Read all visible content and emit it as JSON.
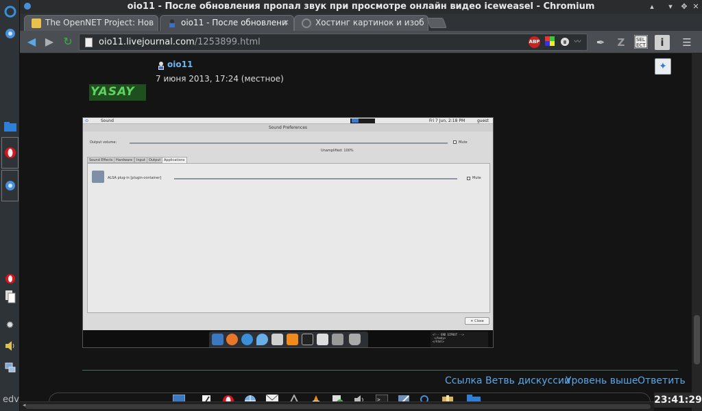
{
  "window": {
    "title": "oio11 - После обновления пропал звук при просмотре онлайн видео iceweasel - Chromium"
  },
  "tabs": [
    {
      "label": "The OpenNET Project: Нов",
      "favicon": "opennet-favicon",
      "active": false
    },
    {
      "label": "oio11 - После обновлени",
      "favicon": "livejournal-user-favicon",
      "active": true
    },
    {
      "label": "Хостинг картинок и изоб",
      "favicon": "loading-spinner-favicon",
      "active": false
    }
  ],
  "toolbar": {
    "url_host": "oio11.livejournal.com",
    "url_path": "/1253899.html",
    "extensions": [
      "adblock-icon",
      "color-picker-icon",
      "password-icon",
      "feed-icon"
    ]
  },
  "post": {
    "username": "oio11",
    "date": "7 июня 2013, 17:24 (местное)",
    "avatar_text": "YASAY"
  },
  "embedded_screenshot": {
    "app_title": "Sound",
    "clock": "Fri 7 Jun,  2:18 PM",
    "user": "guest",
    "window_title": "Sound Preferences",
    "output_volume_label": "Output volume:",
    "mute_label": "Mute",
    "unamplified_label": "Unamplified: 100%",
    "tabs": [
      "Sound Effects",
      "Hardware",
      "Input",
      "Output",
      "Applications"
    ],
    "app_entry": "ALSA plug-in [plugin-container]",
    "close_label": "✕ Close",
    "code_text": "<!-- END EZPOOT -->\n </body>\n</html>"
  },
  "post_links": {
    "link": "Ссылка",
    "thread": "Ветвь дискуссии",
    "parent": "Уровень выше",
    "reply": "Ответить"
  },
  "left_panel": {
    "bottom_text": "edv"
  },
  "clock": "23:41:29",
  "colors": {
    "link_blue": "#5aa7e6",
    "page_bg": "#141414",
    "chrome_toolbar": "#4a4e52"
  }
}
